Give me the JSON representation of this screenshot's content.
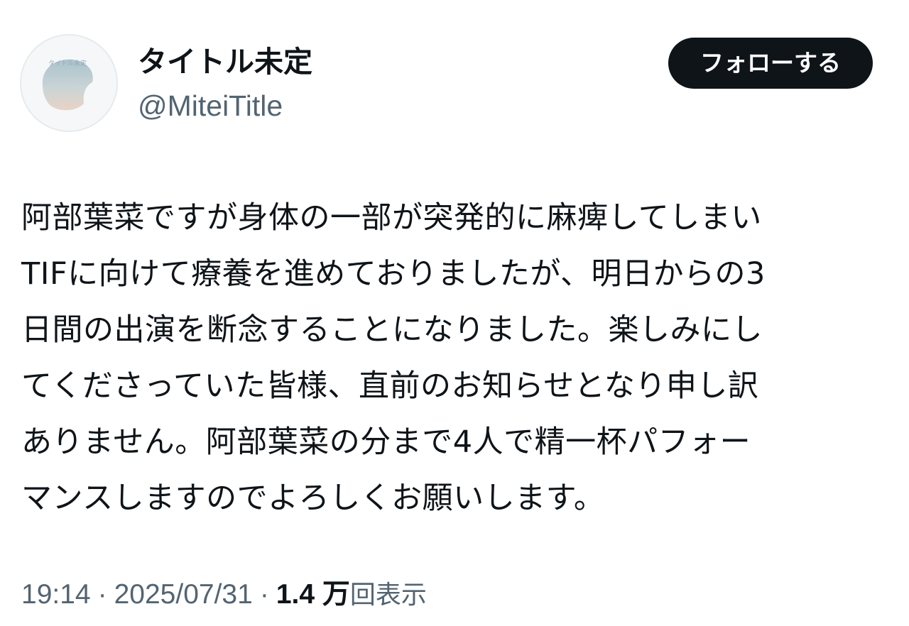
{
  "author": {
    "display_name": "タイトル未定",
    "handle": "@MiteiTitle",
    "avatar_text": "タイトル未定"
  },
  "follow_button": {
    "label": "フォローする"
  },
  "tweet": {
    "lines": [
      "阿部葉菜ですが身体の一部が突発的に麻痺してしまい",
      "TIFに向けて療養を進めておりましたが、明日からの3",
      "日間の出演を断念することになりました。楽しみにし",
      "てくださっていた皆様、直前のお知らせとなり申し訳",
      "ありません。阿部葉菜の分まで4人で精一杯パフォー",
      "マンスしますのでよろしくお願いします。"
    ]
  },
  "meta": {
    "time": "19:14",
    "separator": "·",
    "date": "2025/07/31",
    "views_count": "1.4 万",
    "views_label": "回表示"
  },
  "colors": {
    "text_primary": "#0f1419",
    "text_secondary": "#536471",
    "button_bg": "#0f1419",
    "button_text": "#ffffff",
    "background": "#ffffff"
  }
}
